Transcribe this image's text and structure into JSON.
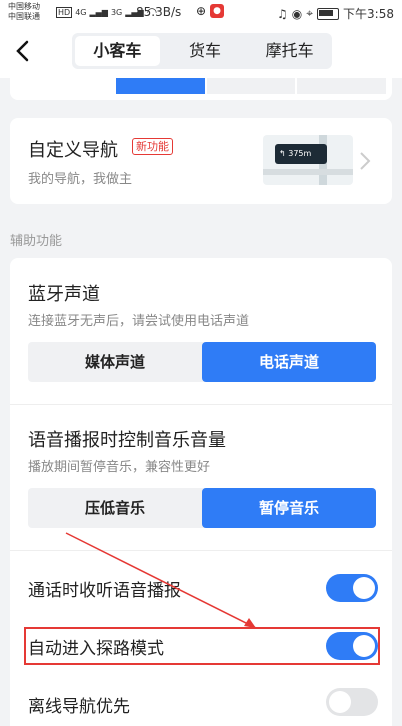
{
  "status_bar": {
    "carrier_1": "中国移动",
    "carrier_2": "中国联通",
    "hd": "HD",
    "net_4g": "4G",
    "net_3g": "3G",
    "speed": "85.3B/s",
    "time": "下午3:58"
  },
  "nav": {
    "tabs": [
      "小客车",
      "货车",
      "摩托车"
    ],
    "active_tab": "小客车"
  },
  "custom_nav": {
    "title": "自定义导航",
    "badge": "新功能",
    "subtitle": "我的导航，我做主",
    "preview_distance": "375",
    "preview_unit": "m"
  },
  "assist": {
    "section_title": "辅助功能",
    "bluetooth": {
      "title": "蓝牙声道",
      "subtitle": "连接蓝牙无声后，请尝试使用电话声道",
      "options": [
        "媒体声道",
        "电话声道"
      ],
      "selected": "电话声道"
    },
    "music": {
      "title": "语音播报时控制音乐音量",
      "subtitle": "播放期间暂停音乐，兼容性更好",
      "options": [
        "压低音乐",
        "暂停音乐"
      ],
      "selected": "暂停音乐"
    },
    "toggles": [
      {
        "label": "通话时收听语音播报",
        "on": true
      },
      {
        "label": "自动进入探路模式",
        "on": true
      },
      {
        "label": "离线导航优先",
        "on": false
      }
    ]
  },
  "colors": {
    "accent": "#2f7cf6",
    "annotation": "#e53935",
    "background": "#f2f3f5"
  }
}
